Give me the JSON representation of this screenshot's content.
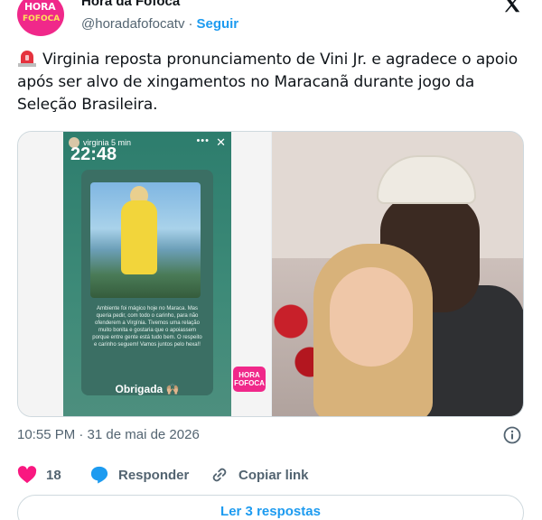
{
  "header": {
    "display_name": "Hora da Fofoca",
    "handle": "@horadafofocatv",
    "separator": "·",
    "follow_label": "Seguir",
    "avatar_text_top": "HORA",
    "avatar_text_bottom": "FOFOCA"
  },
  "tweet": {
    "text": "Virginia reposta pronunciamento de Vini Jr. e agradece o apoio após ser alvo de xingamentos no Maracanã durante jogo da Seleção Brasileira."
  },
  "media": {
    "story": {
      "username": "virginia",
      "time_ago": "5 min",
      "clock": "22:48",
      "caption": "Ambiente foi mágico hoje no Maraca. Mas queria pedir, com todo o carinho, para não ofenderem a Virgínia. Tivemos uma relação muito bonita e gostaria que o apoiassem porque entre gente está tudo bem. O respeito e carinho seguem! Vamos juntos pelo hexa!!",
      "thanks": "Obrigada 🙌🏼",
      "badge_top": "HORA",
      "badge_bottom": "FOFOCA"
    }
  },
  "timestamp": "10:55 PM · 31 de mai de 2026",
  "actions": {
    "likes_count": "18",
    "reply_label": "Responder",
    "copy_label": "Copiar link"
  },
  "read_replies_label": "Ler 3 respostas",
  "colors": {
    "accent": "#1d9bf0",
    "like": "#f91880",
    "brand": "#f0288a",
    "muted": "#536471"
  }
}
